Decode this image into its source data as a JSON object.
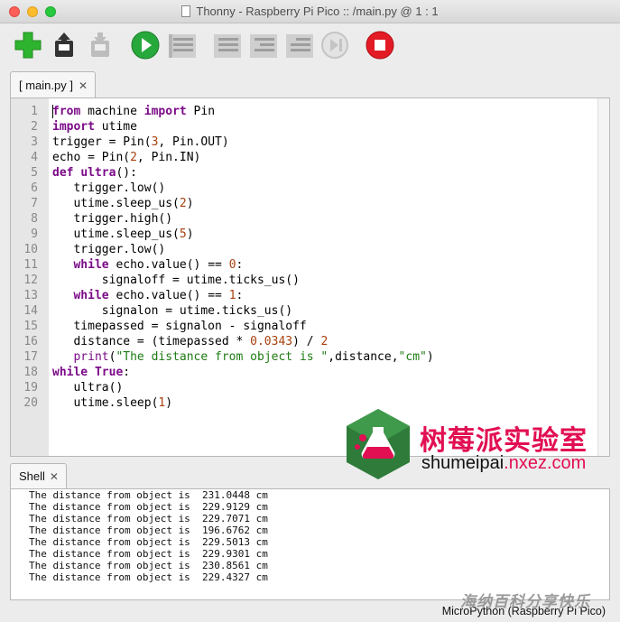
{
  "window": {
    "title": "Thonny  -  Raspberry Pi Pico :: /main.py  @  1 : 1"
  },
  "toolbar": {
    "buttons": [
      {
        "name": "new-file-icon"
      },
      {
        "name": "load-icon"
      },
      {
        "name": "save-icon"
      },
      {
        "name": "run-icon"
      },
      {
        "name": "debug-icon"
      },
      {
        "name": "step-over-icon"
      },
      {
        "name": "step-into-icon"
      },
      {
        "name": "step-out-icon"
      },
      {
        "name": "resume-icon"
      },
      {
        "name": "stop-icon"
      }
    ],
    "colors": {
      "new": "#2fb42f",
      "run": "#27a83b",
      "stop": "#e21b25",
      "disabled": "#bfbfbf"
    }
  },
  "editor": {
    "tab_label": "[ main.py ]",
    "tab_close": "✕",
    "line_numbers": [
      "1",
      "2",
      "3",
      "4",
      "5",
      "6",
      "7",
      "8",
      "9",
      "10",
      "11",
      "12",
      "13",
      "14",
      "15",
      "16",
      "17",
      "18",
      "19",
      "20"
    ],
    "lines": [
      [
        {
          "t": "kw",
          "s": "from"
        },
        {
          "t": "",
          "s": " machine "
        },
        {
          "t": "kw",
          "s": "import"
        },
        {
          "t": "",
          "s": " Pin"
        }
      ],
      [
        {
          "t": "kw",
          "s": "import"
        },
        {
          "t": "",
          "s": " utime"
        }
      ],
      [
        {
          "t": "",
          "s": "trigger = Pin("
        },
        {
          "t": "num",
          "s": "3"
        },
        {
          "t": "",
          "s": ", Pin.OUT)"
        }
      ],
      [
        {
          "t": "",
          "s": "echo = Pin("
        },
        {
          "t": "num",
          "s": "2"
        },
        {
          "t": "",
          "s": ", Pin.IN)"
        }
      ],
      [
        {
          "t": "kw",
          "s": "def"
        },
        {
          "t": "",
          "s": " "
        },
        {
          "t": "kw",
          "s": "ultra"
        },
        {
          "t": "",
          "s": "():"
        }
      ],
      [
        {
          "t": "",
          "s": "   trigger.low()"
        }
      ],
      [
        {
          "t": "",
          "s": "   utime.sleep_us("
        },
        {
          "t": "num",
          "s": "2"
        },
        {
          "t": "",
          "s": ")"
        }
      ],
      [
        {
          "t": "",
          "s": "   trigger.high()"
        }
      ],
      [
        {
          "t": "",
          "s": "   utime.sleep_us("
        },
        {
          "t": "num",
          "s": "5"
        },
        {
          "t": "",
          "s": ")"
        }
      ],
      [
        {
          "t": "",
          "s": "   trigger.low()"
        }
      ],
      [
        {
          "t": "",
          "s": "   "
        },
        {
          "t": "kw",
          "s": "while"
        },
        {
          "t": "",
          "s": " echo.value() == "
        },
        {
          "t": "num",
          "s": "0"
        },
        {
          "t": "",
          "s": ":"
        }
      ],
      [
        {
          "t": "",
          "s": "       signaloff = utime.ticks_us()"
        }
      ],
      [
        {
          "t": "",
          "s": "   "
        },
        {
          "t": "kw",
          "s": "while"
        },
        {
          "t": "",
          "s": " echo.value() == "
        },
        {
          "t": "num",
          "s": "1"
        },
        {
          "t": "",
          "s": ":"
        }
      ],
      [
        {
          "t": "",
          "s": "       signalon = utime.ticks_us()"
        }
      ],
      [
        {
          "t": "",
          "s": "   timepassed = signalon - signaloff"
        }
      ],
      [
        {
          "t": "",
          "s": "   distance = (timepassed * "
        },
        {
          "t": "num",
          "s": "0.0343"
        },
        {
          "t": "",
          "s": ") / "
        },
        {
          "t": "num",
          "s": "2"
        }
      ],
      [
        {
          "t": "",
          "s": "   "
        },
        {
          "t": "bi",
          "s": "print"
        },
        {
          "t": "",
          "s": "("
        },
        {
          "t": "str",
          "s": "\"The distance from object is \""
        },
        {
          "t": "",
          "s": ",distance,"
        },
        {
          "t": "str",
          "s": "\"cm\""
        },
        {
          "t": "",
          "s": ")"
        }
      ],
      [
        {
          "t": "kw",
          "s": "while"
        },
        {
          "t": "",
          "s": " "
        },
        {
          "t": "kw",
          "s": "True"
        },
        {
          "t": "",
          "s": ":"
        }
      ],
      [
        {
          "t": "",
          "s": "   ultra()"
        }
      ],
      [
        {
          "t": "",
          "s": "   utime.sleep("
        },
        {
          "t": "num",
          "s": "1"
        },
        {
          "t": "",
          "s": ")"
        }
      ]
    ]
  },
  "shell": {
    "tab_label": "Shell",
    "tab_close": "✕",
    "output": [
      "The distance from object is  231.0448 cm",
      "The distance from object is  229.9129 cm",
      "The distance from object is  229.7071 cm",
      "The distance from object is  196.6762 cm",
      "The distance from object is  229.5013 cm",
      "The distance from object is  229.9301 cm",
      "The distance from object is  230.8561 cm",
      "The distance from object is  229.4327 cm"
    ]
  },
  "status": {
    "interpreter": "MicroPython (Raspberry Pi Pico)"
  },
  "watermark": {
    "brand": "树莓派实验室",
    "url_prefix": "shumeipai",
    "url_suffix": ".nxez.com",
    "corner": "海纳百科分享快乐"
  }
}
